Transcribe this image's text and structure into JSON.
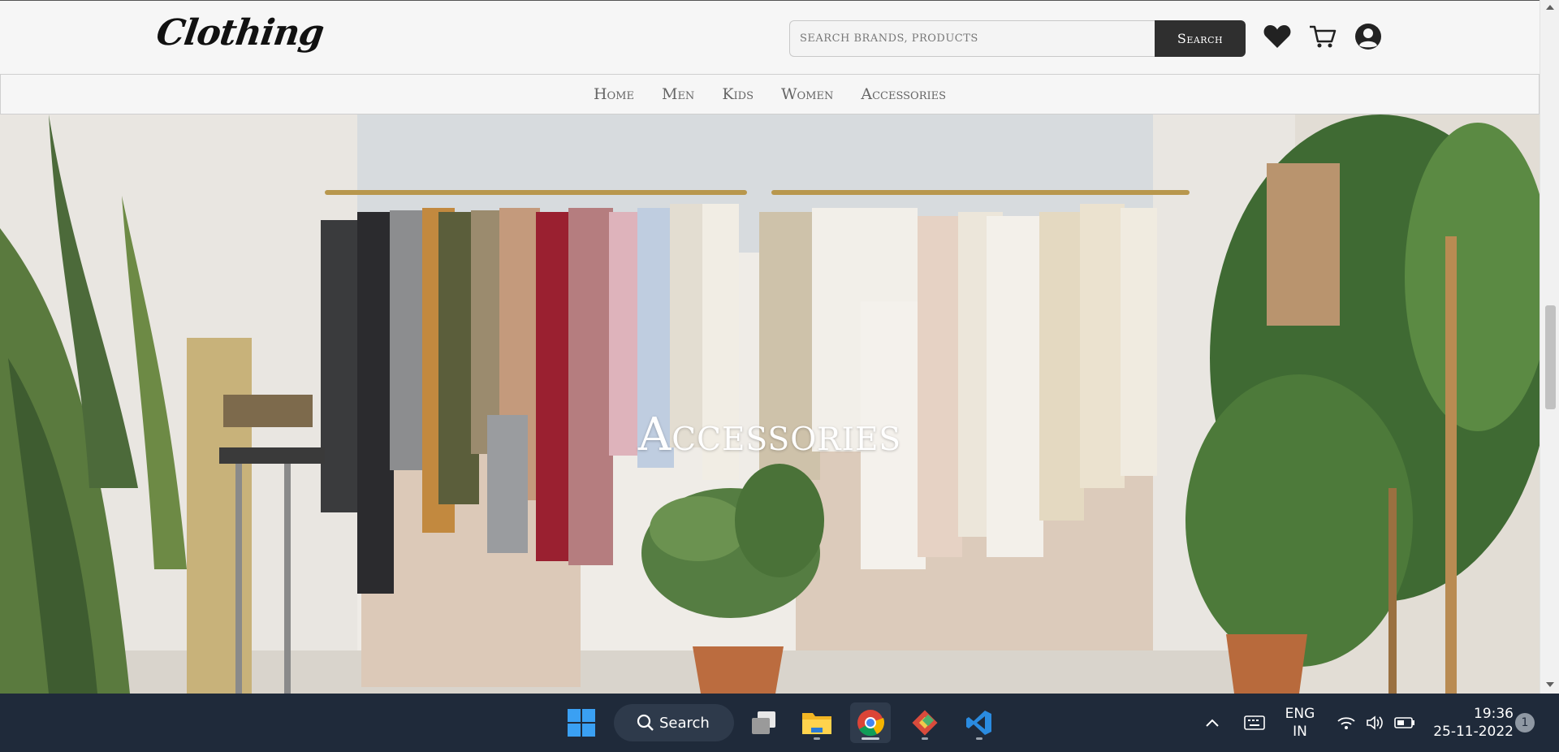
{
  "site": {
    "logo": "Clothing",
    "search": {
      "placeholder": "SEARCH BRANDS, PRODUCTS",
      "button_label": "Search"
    },
    "icons": {
      "wishlist": "heart-icon",
      "cart": "cart-icon",
      "account": "user-circle-icon"
    }
  },
  "nav": {
    "items": [
      {
        "label": "Home"
      },
      {
        "label": "Men"
      },
      {
        "label": "Kids"
      },
      {
        "label": "Women"
      },
      {
        "label": "Accessories"
      }
    ]
  },
  "hero": {
    "title": "Accessories"
  },
  "taskbar": {
    "search_label": "Search",
    "language": {
      "line1": "ENG",
      "line2": "IN"
    },
    "clock": {
      "time": "19:36",
      "date": "25-11-2022"
    },
    "notification_count": "1",
    "apps": [
      "windows-start-icon",
      "task-view-icon",
      "file-explorer-icon",
      "chrome-icon",
      "git-icon",
      "vscode-icon"
    ]
  },
  "colors": {
    "page_bg": "#f4f4f4",
    "search_button_bg": "#2f2f2f",
    "nav_text": "#666666",
    "taskbar_bg": "#1f2a3a"
  }
}
